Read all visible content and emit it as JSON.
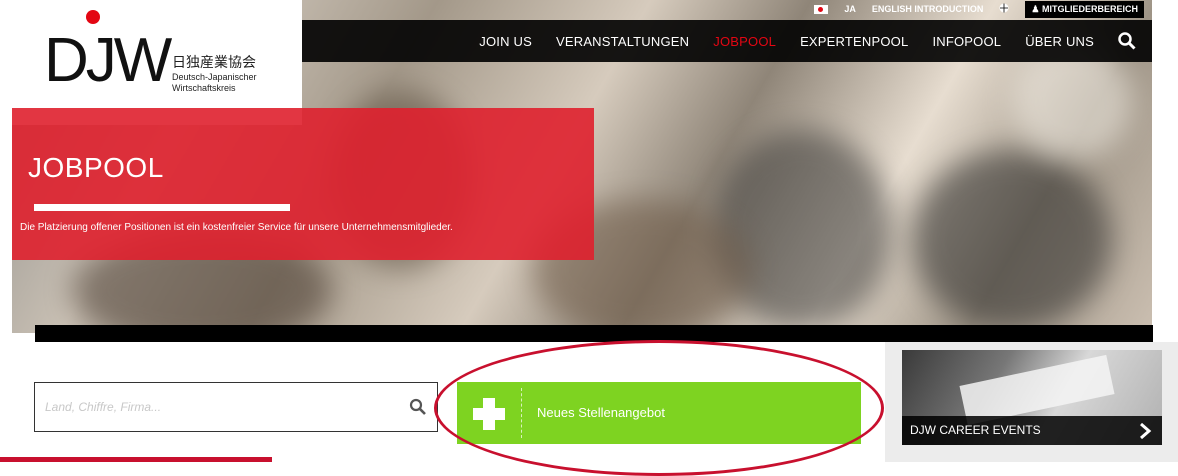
{
  "topbar": {
    "lang": "JA",
    "english": "ENGLISH INTRODUCTION",
    "members": "MITGLIEDERBEREICH"
  },
  "nav": {
    "items": [
      {
        "label": "JOIN US",
        "active": false
      },
      {
        "label": "VERANSTALTUNGEN",
        "active": false
      },
      {
        "label": "JOBPOOL",
        "active": true
      },
      {
        "label": "EXPERTENPOOL",
        "active": false
      },
      {
        "label": "INFOPOOL",
        "active": false
      },
      {
        "label": "ÜBER UNS",
        "active": false
      }
    ],
    "search_icon": "search-icon"
  },
  "logo": {
    "letters": "DJW",
    "kanji": "日独産業協会",
    "line1": "Deutsch-Japanischer",
    "line2": "Wirtschaftskreis"
  },
  "hero": {
    "title": "JOBPOOL",
    "description": "Die Platzierung offener Positionen ist ein kostenfreier Service für unsere Unternehmensmitglieder."
  },
  "search": {
    "placeholder": "Land, Chiffre, Firma..."
  },
  "cta": {
    "label": "Neues Stellenangebot",
    "icon": "plus-icon"
  },
  "sidebar": {
    "career_label": "DJW CAREER EVENTS"
  },
  "colors": {
    "brand_red": "#e30613",
    "cta_green": "#7ed321",
    "highlight_red": "#c8102e"
  }
}
